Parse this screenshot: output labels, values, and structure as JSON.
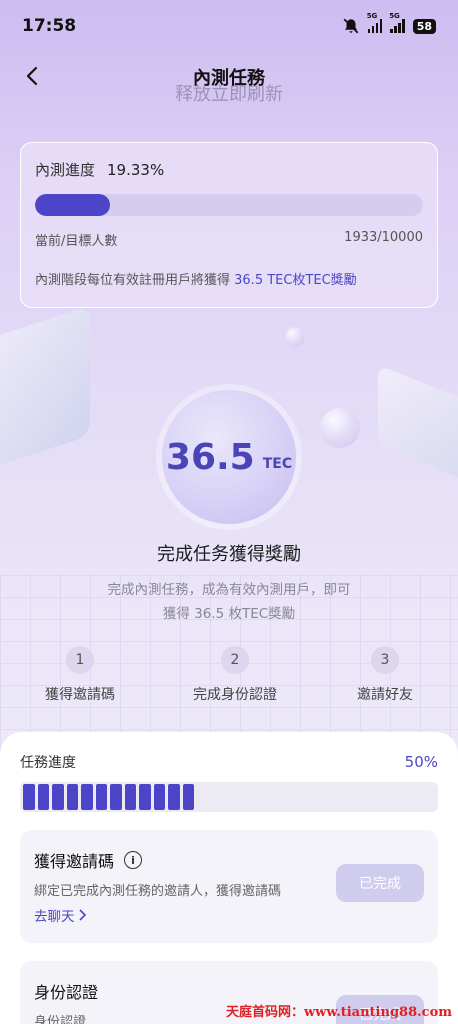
{
  "status_bar": {
    "time": "17:58",
    "signal_label_1": "5G",
    "signal_label_2": "5G",
    "battery": "58",
    "icons": [
      "mute-icon",
      "signal-icon",
      "signal-icon",
      "battery-icon"
    ]
  },
  "header": {
    "title": "內測任務",
    "refresh_hint": "释放立即刷新"
  },
  "progress_card": {
    "label": "內測進度",
    "percent_text": "19.33%",
    "progress_fraction": 0.1933,
    "count_label": "當前/目標人數",
    "count_value": "1933/10000",
    "note_prefix": "內測階段每位有效註冊用戶將獲得 ",
    "note_accent": "36.5 TEC枚TEC獎勵"
  },
  "reward": {
    "value": "36.5",
    "unit": "TEC",
    "title": "完成任务獲得獎勵",
    "desc_line1": "完成內測任務，成為有效內測用戶，即可",
    "desc_line2": "獲得 36.5 枚TEC獎勵"
  },
  "steps": [
    {
      "num": "1",
      "label": "獲得邀請碼"
    },
    {
      "num": "2",
      "label": "完成身份認證"
    },
    {
      "num": "3",
      "label": "邀請好友"
    }
  ],
  "task_progress": {
    "label": "任務進度",
    "percent_text": "50%",
    "filled_segments": 12
  },
  "tasks": [
    {
      "title": "獲得邀請碼",
      "desc": "綁定已完成內測任務的邀請人，獲得邀請碼",
      "link": "去聊天",
      "button": "已完成"
    },
    {
      "title": "身份認證",
      "desc": "身份認證",
      "button": "已完成"
    }
  ],
  "watermark": "天庭首码网：www.tianting88.com",
  "colors": {
    "accent": "#4d45c7",
    "accent_text": "#4b47c8",
    "done_button": "#cfccee"
  }
}
